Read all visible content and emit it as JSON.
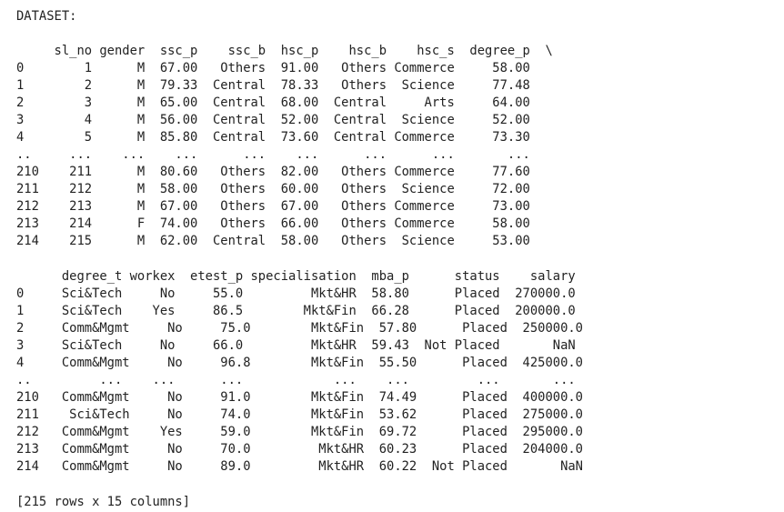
{
  "output": {
    "title": "DATASET:",
    "table1": {
      "header": "     sl_no gender  ssc_p    ssc_b  hsc_p    hsc_b    hsc_s  degree_p  \\",
      "rows": [
        "0        1      M  67.00   Others  91.00   Others Commerce     58.00",
        "1        2      M  79.33  Central  78.33   Others  Science     77.48",
        "2        3      M  65.00  Central  68.00  Central     Arts     64.00",
        "3        4      M  56.00  Central  52.00  Central  Science     52.00",
        "4        5      M  85.80  Central  73.60  Central Commerce     73.30",
        "..     ...    ...    ...      ...    ...      ...      ...       ...",
        "210    211      M  80.60   Others  82.00   Others Commerce     77.60",
        "211    212      M  58.00   Others  60.00   Others  Science     72.00",
        "212    213      M  67.00   Others  67.00   Others Commerce     73.00",
        "213    214      F  74.00   Others  66.00   Others Commerce     58.00",
        "214    215      M  62.00  Central  58.00   Others  Science     53.00"
      ]
    },
    "table2": {
      "header": "      degree_t workex  etest_p specialisation  mba_p      status    salary",
      "rows": [
        "0     Sci&Tech     No     55.0         Mkt&HR  58.80      Placed  270000.0",
        "1     Sci&Tech    Yes     86.5        Mkt&Fin  66.28      Placed  200000.0",
        "2     Comm&Mgmt     No     75.0        Mkt&Fin  57.80      Placed  250000.0",
        "3     Sci&Tech     No     66.0         Mkt&HR  59.43  Not Placed       NaN",
        "4     Comm&Mgmt     No     96.8        Mkt&Fin  55.50      Placed  425000.0",
        "..         ...    ...      ...            ...    ...         ...       ...",
        "210   Comm&Mgmt     No     91.0        Mkt&Fin  74.49      Placed  400000.0",
        "211    Sci&Tech     No     74.0        Mkt&Fin  53.62      Placed  275000.0",
        "212   Comm&Mgmt    Yes     59.0        Mkt&Fin  69.72      Placed  295000.0",
        "213   Comm&Mgmt     No     70.0         Mkt&HR  60.23      Placed  204000.0",
        "214   Comm&Mgmt     No     89.0         Mkt&HR  60.22  Not Placed       NaN"
      ]
    },
    "footer": "[215 rows x 15 columns]"
  }
}
